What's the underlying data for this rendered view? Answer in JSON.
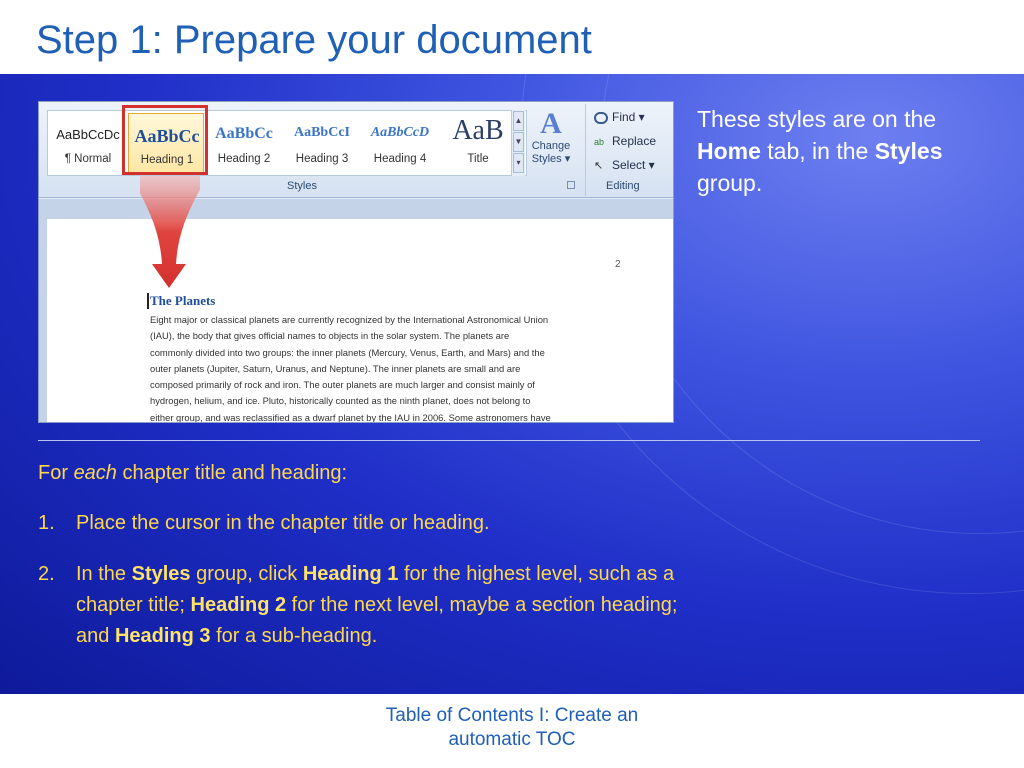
{
  "slide": {
    "title": "Step 1: Prepare your document",
    "footer_line1": "Table of Contents I: Create an",
    "footer_line2": "automatic TOC"
  },
  "ribbon": {
    "styles": [
      {
        "sample": "AaBbCcDc",
        "name": "¶ Normal"
      },
      {
        "sample": "AaBbCc",
        "name": "Heading 1"
      },
      {
        "sample": "AaBbCc",
        "name": "Heading 2"
      },
      {
        "sample": "AaBbCcI",
        "name": "Heading 3"
      },
      {
        "sample": "AaBbCcD",
        "name": "Heading 4"
      },
      {
        "sample": "AaB",
        "name": "Title"
      }
    ],
    "styles_group_label": "Styles",
    "change_styles_line1": "Change",
    "change_styles_line2": "Styles ▾",
    "find": "Find ▾",
    "replace": "Replace",
    "select": "Select ▾",
    "editing_group_label": "Editing"
  },
  "document": {
    "page_number": "2",
    "heading": "The Planets",
    "body_lines": [
      "Eight major or classical planets are currently recognized by the International Astronomical Union",
      "(IAU), the body that gives official names to objects in the solar system. The planets are",
      "commonly divided into two groups: the inner planets (Mercury, Venus, Earth, and Mars) and the",
      "outer planets (Jupiter, Saturn, Uranus, and Neptune). The inner planets are small and are",
      "composed primarily of rock and iron. The outer planets are much larger and consist mainly of",
      "hydrogen, helium, and ice. Pluto, historically counted as the ninth planet, does not belong to",
      "either group, and was reclassified as a dwarf planet by the IAU in 2006. Some astronomers have"
    ]
  },
  "callout": {
    "part1": "These styles are on the ",
    "home": "Home",
    "part2": " tab, in the ",
    "styles": "Styles",
    "part3": " group."
  },
  "instructions": {
    "intro_pre": "For ",
    "intro_each": "each",
    "intro_post": " chapter title and heading:",
    "step1_num": "1.",
    "step1_text": "Place the cursor in the chapter title or heading.",
    "step2_num": "2.",
    "step2_a": "In the ",
    "step2_styles": "Styles",
    "step2_b": " group, click ",
    "step2_h1": "Heading 1",
    "step2_c": " for the highest level, such as a chapter title; ",
    "step2_h2": "Heading 2",
    "step2_d": " for the next level, maybe a section heading; and ",
    "step2_h3": "Heading 3",
    "step2_e": " for a sub-heading."
  },
  "colors": {
    "title_blue": "#1f5fb5",
    "instruction_yellow": "#ffd84a",
    "highlight_red": "#d4302d"
  }
}
